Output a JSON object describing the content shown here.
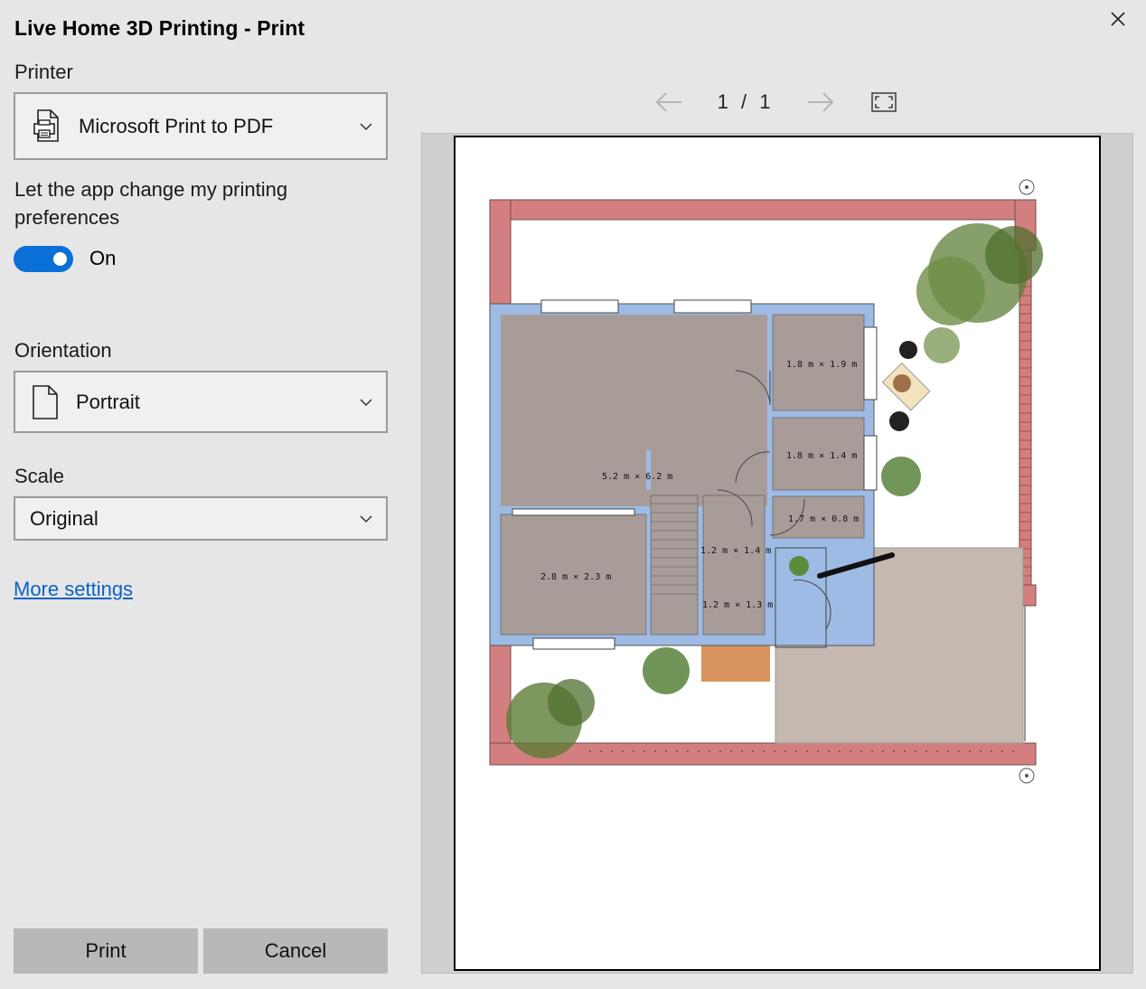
{
  "window": {
    "title": "Live Home 3D Printing - Print"
  },
  "printer": {
    "label": "Printer",
    "value": "Microsoft Print to PDF"
  },
  "preferences": {
    "text": "Let the app change my printing preferences",
    "toggle_label": "On",
    "toggle_on": true
  },
  "orientation": {
    "label": "Orientation",
    "value": "Portrait"
  },
  "scale": {
    "label": "Scale",
    "value": "Original"
  },
  "more_settings": "More settings",
  "buttons": {
    "print": "Print",
    "cancel": "Cancel"
  },
  "pager": {
    "current": "1",
    "separator": "/",
    "total": "1"
  },
  "floorplan": {
    "rooms": [
      {
        "label": "5.2 m × 6.2 m"
      },
      {
        "label": "1.8 m × 1.9 m"
      },
      {
        "label": "1.8 m × 1.4 m"
      },
      {
        "label": "1.7 m × 0.8 m"
      },
      {
        "label": "1.2 m × 1.4 m"
      },
      {
        "label": "1.2 m × 1.3 m"
      },
      {
        "label": "2.8 m × 2.3 m"
      }
    ]
  },
  "colors": {
    "accent": "#0a6fd6",
    "link": "#0a63c4",
    "exterior_wall": "#d47f7f",
    "interior_wall": "#9dbbe4",
    "floor": "#a89c98"
  }
}
